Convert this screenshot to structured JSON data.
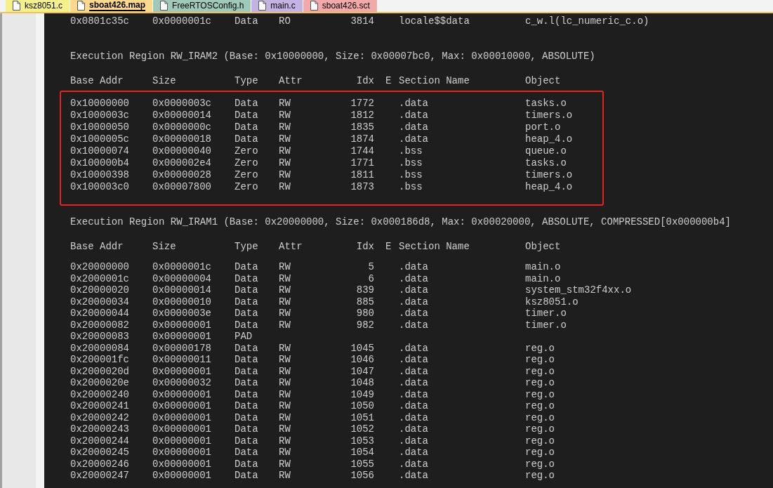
{
  "tabs": [
    {
      "label": "ksz8051.c",
      "color": "#f4f08e",
      "selected": false
    },
    {
      "label": "sboat426.map",
      "color": "#fcd98c",
      "selected": true
    },
    {
      "label": "FreeRTOSConfig.h",
      "color": "#9fc9b8",
      "selected": false
    },
    {
      "label": "main.c",
      "color": "#c3b3e3",
      "selected": false
    },
    {
      "label": "sboat426.sct",
      "color": "#f1a9a9",
      "selected": false
    }
  ],
  "blocks": [
    {
      "kind": "rows",
      "rows": [
        {
          "base": "0x0801c35c",
          "size": "0x0000001c",
          "type": "Data",
          "attr": "RO",
          "idx": "3814",
          "e": "",
          "section": "locale$$data",
          "object": "c_w.l(lc_numeric_c.o)"
        }
      ]
    },
    {
      "kind": "region",
      "text": "Execution Region RW_IRAM2 (Base: 0x10000000, Size: 0x00007bc0, Max: 0x00010000, ABSOLUTE)"
    },
    {
      "kind": "header",
      "columns": [
        "Base Addr",
        "Size",
        "Type",
        "Attr",
        "Idx",
        "E",
        "Section Name",
        "Object"
      ]
    },
    {
      "kind": "boxed_rows",
      "rows": [
        {
          "base": "0x10000000",
          "size": "0x0000003c",
          "type": "Data",
          "attr": "RW",
          "idx": "1772",
          "e": "",
          "section": ".data",
          "object": "tasks.o"
        },
        {
          "base": "0x1000003c",
          "size": "0x00000014",
          "type": "Data",
          "attr": "RW",
          "idx": "1812",
          "e": "",
          "section": ".data",
          "object": "timers.o"
        },
        {
          "base": "0x10000050",
          "size": "0x0000000c",
          "type": "Data",
          "attr": "RW",
          "idx": "1835",
          "e": "",
          "section": ".data",
          "object": "port.o"
        },
        {
          "base": "0x1000005c",
          "size": "0x00000018",
          "type": "Data",
          "attr": "RW",
          "idx": "1874",
          "e": "",
          "section": ".data",
          "object": "heap_4.o"
        },
        {
          "base": "0x10000074",
          "size": "0x00000040",
          "type": "Zero",
          "attr": "RW",
          "idx": "1744",
          "e": "",
          "section": ".bss",
          "object": "queue.o"
        },
        {
          "base": "0x100000b4",
          "size": "0x000002e4",
          "type": "Zero",
          "attr": "RW",
          "idx": "1771",
          "e": "",
          "section": ".bss",
          "object": "tasks.o"
        },
        {
          "base": "0x10000398",
          "size": "0x00000028",
          "type": "Zero",
          "attr": "RW",
          "idx": "1811",
          "e": "",
          "section": ".bss",
          "object": "timers.o"
        },
        {
          "base": "0x100003c0",
          "size": "0x00007800",
          "type": "Zero",
          "attr": "RW",
          "idx": "1873",
          "e": "",
          "section": ".bss",
          "object": "heap_4.o"
        }
      ]
    },
    {
      "kind": "region",
      "text": "Execution Region RW_IRAM1 (Base: 0x20000000, Size: 0x000186d8, Max: 0x00020000, ABSOLUTE, COMPRESSED[0x000000b4]"
    },
    {
      "kind": "header",
      "columns": [
        "Base Addr",
        "Size",
        "Type",
        "Attr",
        "Idx",
        "E",
        "Section Name",
        "Object"
      ]
    },
    {
      "kind": "rows",
      "rows": [
        {
          "base": "0x20000000",
          "size": "0x0000001c",
          "type": "Data",
          "attr": "RW",
          "idx": "5",
          "e": "",
          "section": ".data",
          "object": "main.o"
        },
        {
          "base": "0x2000001c",
          "size": "0x00000004",
          "type": "Data",
          "attr": "RW",
          "idx": "6",
          "e": "",
          "section": ".data",
          "object": "main.o"
        },
        {
          "base": "0x20000020",
          "size": "0x00000014",
          "type": "Data",
          "attr": "RW",
          "idx": "839",
          "e": "",
          "section": ".data",
          "object": "system_stm32f4xx.o"
        },
        {
          "base": "0x20000034",
          "size": "0x00000010",
          "type": "Data",
          "attr": "RW",
          "idx": "885",
          "e": "",
          "section": ".data",
          "object": "ksz8051.o"
        },
        {
          "base": "0x20000044",
          "size": "0x0000003e",
          "type": "Data",
          "attr": "RW",
          "idx": "980",
          "e": "",
          "section": ".data",
          "object": "timer.o"
        },
        {
          "base": "0x20000082",
          "size": "0x00000001",
          "type": "Data",
          "attr": "RW",
          "idx": "982",
          "e": "",
          "section": ".data",
          "object": "timer.o"
        },
        {
          "base": "0x20000083",
          "size": "0x00000001",
          "type": "PAD",
          "attr": "",
          "idx": "",
          "e": "",
          "section": "",
          "object": ""
        },
        {
          "base": "0x20000084",
          "size": "0x00000178",
          "type": "Data",
          "attr": "RW",
          "idx": "1045",
          "e": "",
          "section": ".data",
          "object": "reg.o"
        },
        {
          "base": "0x200001fc",
          "size": "0x00000011",
          "type": "Data",
          "attr": "RW",
          "idx": "1046",
          "e": "",
          "section": ".data",
          "object": "reg.o"
        },
        {
          "base": "0x2000020d",
          "size": "0x00000001",
          "type": "Data",
          "attr": "RW",
          "idx": "1047",
          "e": "",
          "section": ".data",
          "object": "reg.o"
        },
        {
          "base": "0x2000020e",
          "size": "0x00000032",
          "type": "Data",
          "attr": "RW",
          "idx": "1048",
          "e": "",
          "section": ".data",
          "object": "reg.o"
        },
        {
          "base": "0x20000240",
          "size": "0x00000001",
          "type": "Data",
          "attr": "RW",
          "idx": "1049",
          "e": "",
          "section": ".data",
          "object": "reg.o"
        },
        {
          "base": "0x20000241",
          "size": "0x00000001",
          "type": "Data",
          "attr": "RW",
          "idx": "1050",
          "e": "",
          "section": ".data",
          "object": "reg.o"
        },
        {
          "base": "0x20000242",
          "size": "0x00000001",
          "type": "Data",
          "attr": "RW",
          "idx": "1051",
          "e": "",
          "section": ".data",
          "object": "reg.o"
        },
        {
          "base": "0x20000243",
          "size": "0x00000001",
          "type": "Data",
          "attr": "RW",
          "idx": "1052",
          "e": "",
          "section": ".data",
          "object": "reg.o"
        },
        {
          "base": "0x20000244",
          "size": "0x00000001",
          "type": "Data",
          "attr": "RW",
          "idx": "1053",
          "e": "",
          "section": ".data",
          "object": "reg.o"
        },
        {
          "base": "0x20000245",
          "size": "0x00000001",
          "type": "Data",
          "attr": "RW",
          "idx": "1054",
          "e": "",
          "section": ".data",
          "object": "reg.o"
        },
        {
          "base": "0x20000246",
          "size": "0x00000001",
          "type": "Data",
          "attr": "RW",
          "idx": "1055",
          "e": "",
          "section": ".data",
          "object": "reg.o"
        },
        {
          "base": "0x20000247",
          "size": "0x00000001",
          "type": "Data",
          "attr": "RW",
          "idx": "1056",
          "e": "",
          "section": ".data",
          "object": "reg.o"
        }
      ]
    }
  ]
}
